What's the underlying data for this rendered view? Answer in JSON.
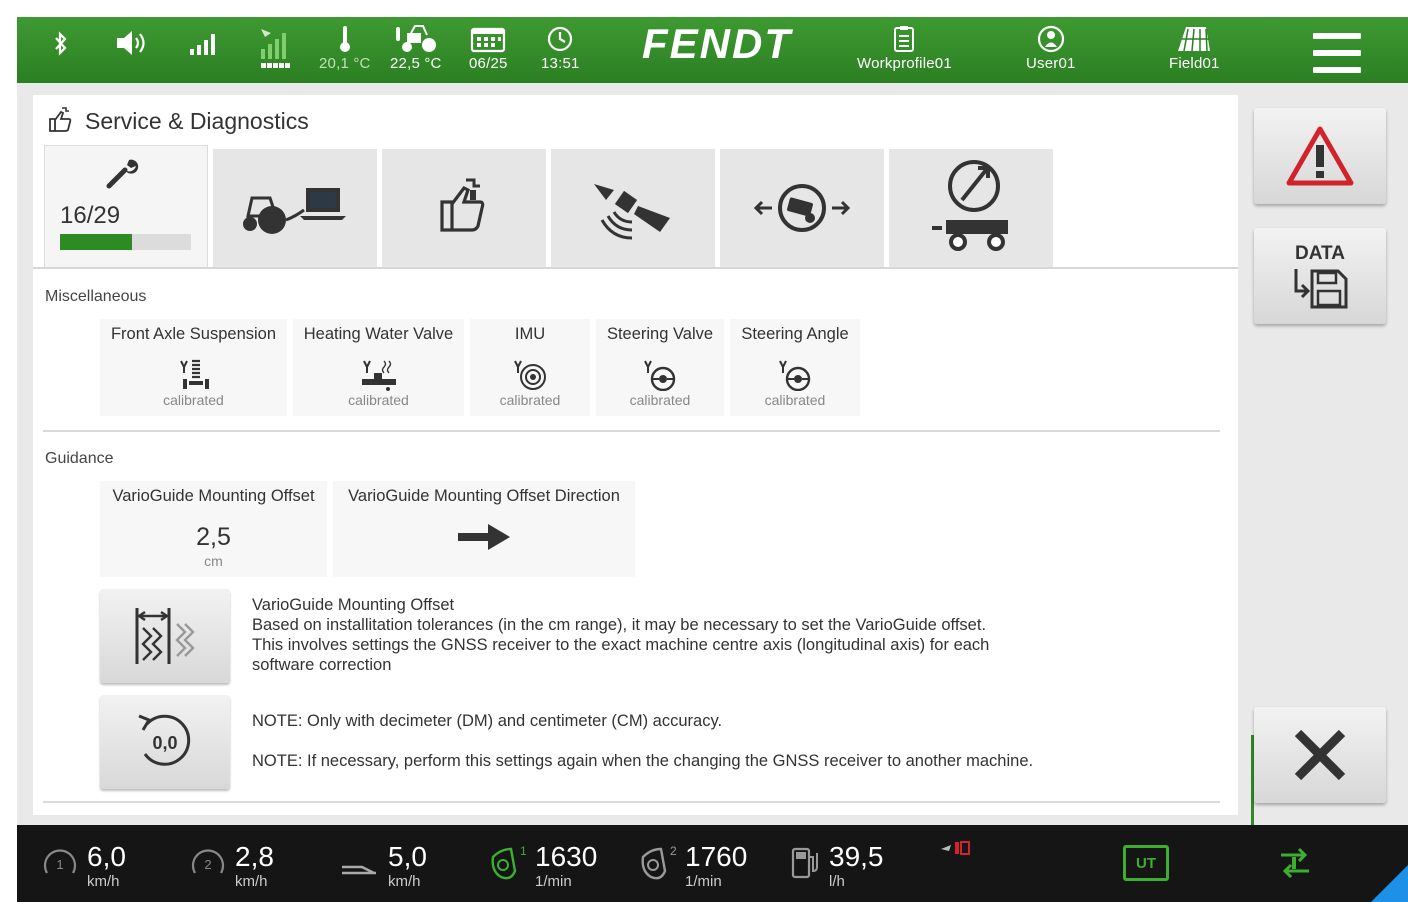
{
  "topbar": {
    "icons": [
      "bluetooth-icon",
      "speaker-icon",
      "signal-icon",
      "gnss-signal-icon",
      "thermometer-icon",
      "tractor-temp-icon",
      "calendar-icon",
      "clock-icon"
    ],
    "outside_temp": "20,1 °C",
    "engine_temp": "22,5 °C",
    "date": "06/25",
    "time": "13:51",
    "brand": "FENDT",
    "workprofile": "Workprofile01",
    "user": "User01",
    "field": "Field01"
  },
  "page": {
    "title": "Service & Diagnostics",
    "tab_progress_label": "16/29",
    "tab_progress_fraction": 0.55,
    "tabs": [
      "wrench-tab",
      "tractor-laptop-tab",
      "calibration-tab",
      "satellite-tab",
      "vehicle-guidance-tab",
      "trailer-compass-tab"
    ]
  },
  "misc": {
    "heading": "Miscellaneous",
    "cards": [
      {
        "name": "Front Axle Suspension",
        "status": "calibrated"
      },
      {
        "name": "Heating Water Valve",
        "status": "calibrated"
      },
      {
        "name": "IMU",
        "status": "calibrated"
      },
      {
        "name": "Steering Valve",
        "status": "calibrated"
      },
      {
        "name": "Steering Angle",
        "status": "calibrated"
      }
    ]
  },
  "guidance": {
    "heading": "Guidance",
    "offset_title": "VarioGuide Mounting Offset",
    "offset_value": "2,5",
    "offset_unit": "cm",
    "direction_title": "VarioGuide Mounting Offset Direction",
    "info_title": "VarioGuide Mounting Offset",
    "info_line1": "Based on installitation tolerances (in the cm range), it may be necessary to set the VarioGuide offset.",
    "info_line2": "This involves settings the GNSS receiver to the exact machine centre axis (longitudinal axis) for each",
    "info_line3": "software correction",
    "reset_label": "0,0",
    "note1": "NOTE: Only with decimeter (DM) and centimeter (CM) accuracy.",
    "note2": "NOTE: If necessary, perform this settings again when the changing the GNSS receiver to another machine."
  },
  "side": {
    "data_label": "DATA"
  },
  "bottom": {
    "speed1": "6,0",
    "speed1_unit": "km/h",
    "speed2": "2,8",
    "speed2_unit": "km/h",
    "speed3": "5,0",
    "speed3_unit": "km/h",
    "rpm1_index": "1",
    "rpm1": "1630",
    "rpm1_unit": "1/min",
    "rpm2_index": "2",
    "rpm2": "1760",
    "rpm2_unit": "1/min",
    "fuel": "39,5",
    "fuel_unit": "l/h",
    "ut_label": "UT"
  },
  "colors": {
    "brand_green": "#2e8a23",
    "warning_red": "#d2232a"
  }
}
